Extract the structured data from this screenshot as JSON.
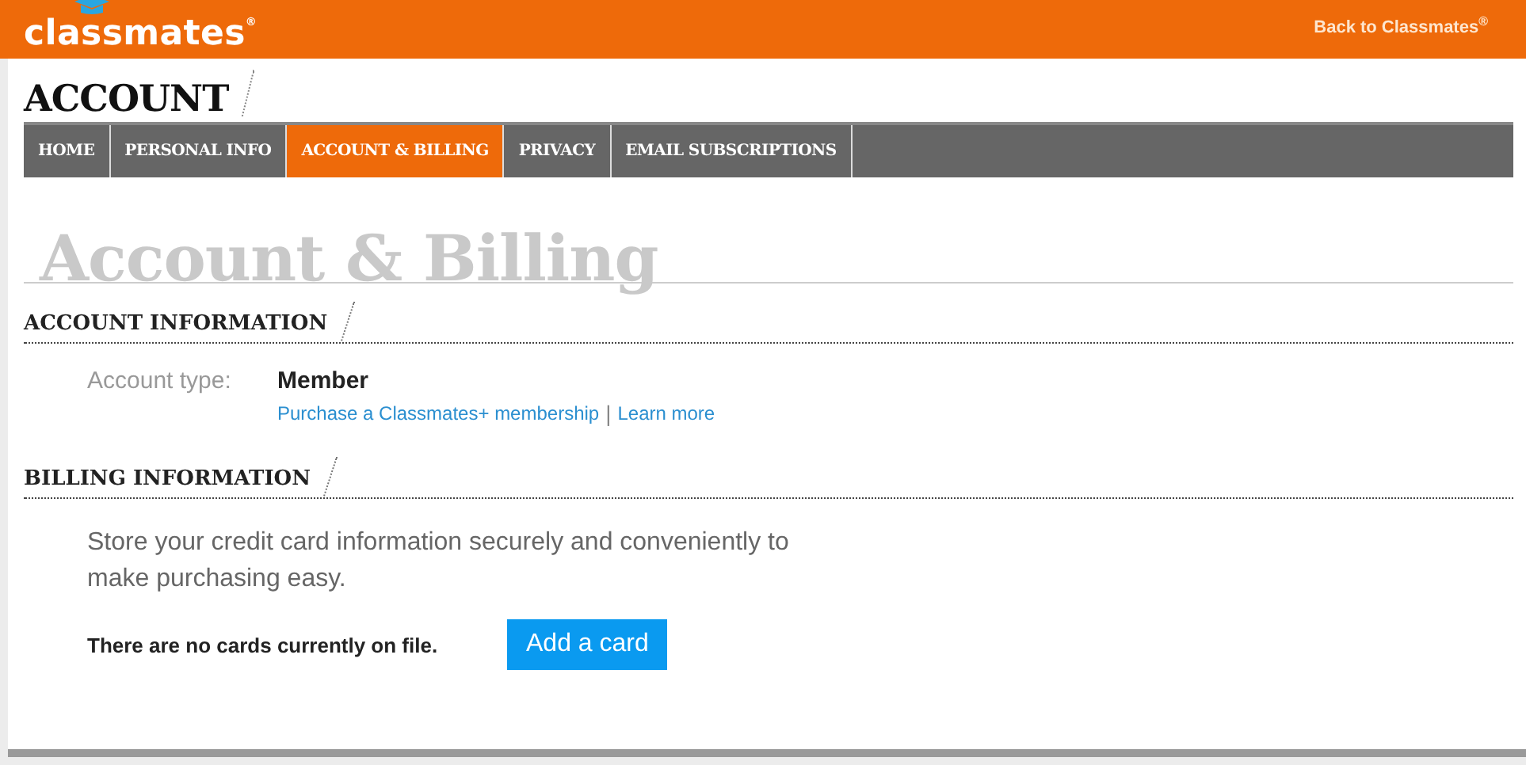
{
  "header": {
    "logo": "classmates$^{®}$",
    "back_link": "Back to Classmates$^{®}$"
  },
  "page_title": "ACCOUNT",
  "tabs": [
    {
      "label": "HOME",
      "selected": false
    },
    {
      "label": "PERSONAL INFO",
      "selected": false
    },
    {
      "label": "ACCOUNT & BILLING",
      "selected": true
    },
    {
      "label": "PRIVACY",
      "selected": false
    },
    {
      "label": "EMAIL SUBSCRIPTIONS",
      "selected": false
    }
  ],
  "heading": "Account & Billing",
  "account_information": {
    "title": "ACCOUNT INFORMATION",
    "label": "Account type:",
    "value": "Member",
    "links": [
      "Purchase a Classmates+ membership",
      "Learn more"
    ],
    "separator": "|"
  },
  "billing_information": {
    "title": "BILLING INFORMATION",
    "description": "Store your credit card information securely and conveniently to make purchasing easy.",
    "status": "There are no cards currently on file.",
    "button": "Add a card"
  }
}
